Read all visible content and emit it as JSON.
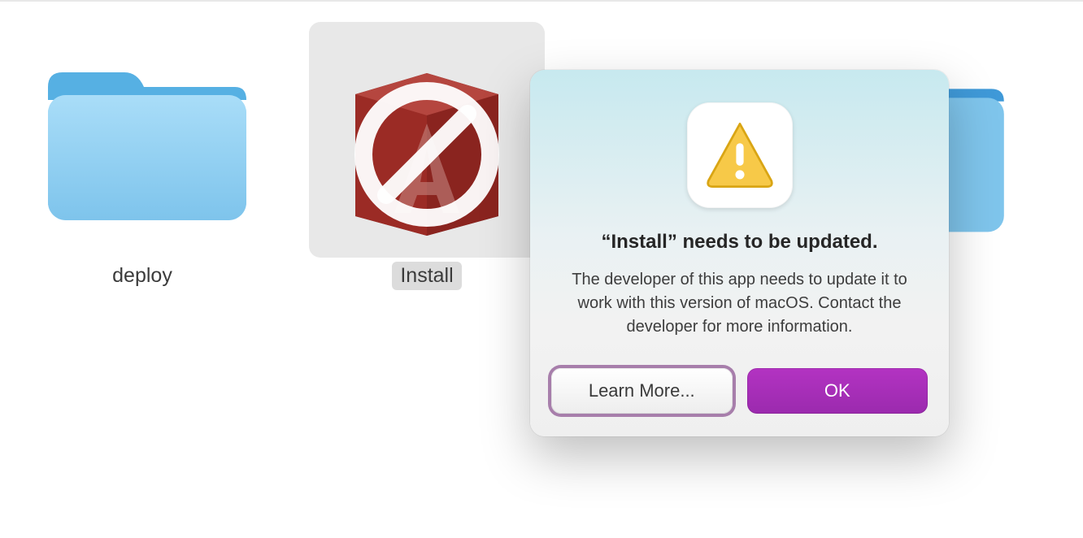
{
  "desktop": {
    "items": [
      {
        "label": "deploy"
      },
      {
        "label": "Install"
      }
    ]
  },
  "dialog": {
    "title": "“Install” needs to be updated.",
    "body": "The developer of this app needs to update it to work with this version of macOS. Contact the developer for more information.",
    "learn_more_label": "Learn More...",
    "ok_label": "OK"
  }
}
